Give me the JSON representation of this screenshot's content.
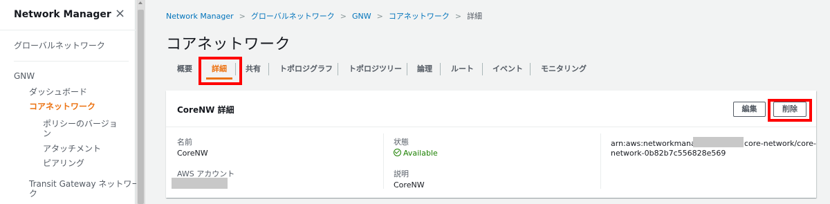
{
  "sidebar": {
    "title": "Network Manager",
    "close_icon": "×",
    "global_network": "グローバルネットワーク",
    "section": "GNW",
    "dashboard": "ダッシュボード",
    "core_network": "コアネットワーク",
    "policy_versions": "ポリシーのバージョ",
    "policy_versions_wrap": "ン",
    "attachments": "アタッチメント",
    "peering": "ピアリング",
    "tgw": "Transit Gateway ネットワー",
    "tgw_wrap": "ク"
  },
  "breadcrumb": {
    "items": [
      "Network Manager",
      "グローバルネットワーク",
      "GNW",
      "コアネットワーク"
    ],
    "current": "詳細",
    "separator": ">"
  },
  "page": {
    "title": "コアネットワーク"
  },
  "tabs": [
    {
      "label": "概要"
    },
    {
      "label": "詳細"
    },
    {
      "label": "共有"
    },
    {
      "label": "トポロジグラフ"
    },
    {
      "label": "トポロジツリー"
    },
    {
      "label": "論理"
    },
    {
      "label": "ルート"
    },
    {
      "label": "イベント"
    },
    {
      "label": "モニタリング"
    }
  ],
  "panel": {
    "title": "CoreNW 詳細",
    "edit_label": "編集",
    "delete_label": "削除",
    "name_label": "名前",
    "name_value": "CoreNW",
    "account_label": "AWS アカウント",
    "state_label": "状態",
    "state_value": "Available",
    "description_label": "説明",
    "description_value": "CoreNW",
    "arn_prefix": "arn:aws:networkmanager::",
    "arn_suffix": "core-network/core-",
    "arn_line2": "network-0b82b7c556828e569"
  },
  "colors": {
    "accent": "#ec7211",
    "link": "#0073bb",
    "success": "#1d8102",
    "highlight": "#ff0000"
  }
}
